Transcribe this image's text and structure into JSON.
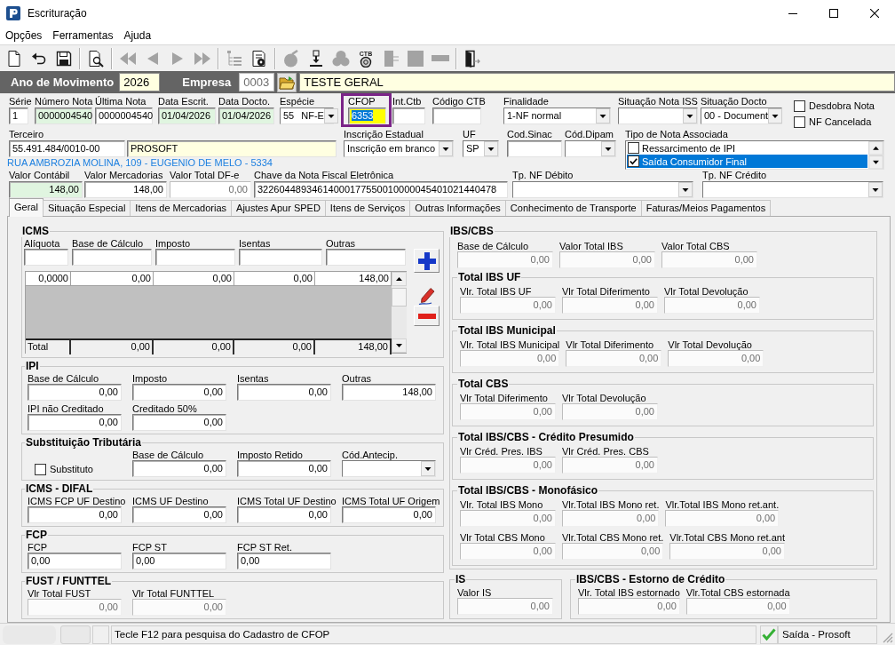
{
  "window": {
    "title": "Escrituração"
  },
  "menu": [
    {
      "label": "Opções"
    },
    {
      "label": "Ferramentas"
    },
    {
      "label": "Ajuda"
    }
  ],
  "toolbar": [
    [
      {
        "kind": "new",
        "disabled": false
      },
      {
        "kind": "undo",
        "disabled": false
      },
      {
        "kind": "save",
        "disabled": false
      }
    ],
    [
      {
        "kind": "preview",
        "disabled": false
      }
    ],
    [
      {
        "kind": "first",
        "disabled": true
      },
      {
        "kind": "previous",
        "disabled": true
      },
      {
        "kind": "next",
        "disabled": true
      },
      {
        "kind": "last",
        "disabled": true
      }
    ],
    [
      {
        "kind": "tree",
        "disabled": true
      },
      {
        "kind": "report",
        "disabled": false
      }
    ],
    [
      {
        "kind": "apple",
        "disabled": true
      },
      {
        "kind": "import",
        "disabled": false
      },
      {
        "kind": "cloud",
        "disabled": true
      },
      {
        "kind": "coin",
        "disabled": false,
        "label": "CTB"
      },
      {
        "kind": "document",
        "disabled": true
      },
      {
        "kind": "panel",
        "disabled": true
      },
      {
        "kind": "bar",
        "disabled": true
      }
    ],
    [
      {
        "kind": "exit",
        "disabled": false
      }
    ]
  ],
  "header": {
    "year_label": "Ano de Movimento",
    "year": {
      "value": "2026",
      "color": "#ffffe1"
    },
    "company_label": "Empresa",
    "company_code": {
      "value": "0003",
      "color": "#ffffff",
      "disabled": true
    },
    "company_name": {
      "value": "TESTE GERAL",
      "color": "#ffffe1"
    }
  },
  "document": {
    "row_1": [
      {
        "label": "Série",
        "value": "1",
        "kind": "text",
        "color": "#ffffff",
        "focused": false,
        "highlighted": false
      },
      {
        "label": "Número Nota",
        "value": "0000004540",
        "kind": "text",
        "color": "#e0f5e0",
        "focused": false,
        "highlighted": false
      },
      {
        "label": "Última Nota",
        "value": "0000004540",
        "kind": "text",
        "color": "#ffffff",
        "focused": false,
        "highlighted": false
      },
      {
        "label": "Data Escrit.",
        "value": "01/04/2026",
        "kind": "text",
        "color": "#e0f5e0",
        "focused": false,
        "highlighted": false
      },
      {
        "label": "Data Docto.",
        "value": "01/04/2026",
        "kind": "text",
        "color": "#e0f5e0",
        "focused": false,
        "highlighted": false
      },
      {
        "label": "Espécie",
        "value": "55",
        "detail": "NF-E",
        "kind": "combo",
        "color": "#ffffff",
        "focused": false,
        "highlighted": false
      },
      {
        "label": "CFOP",
        "value": "6353",
        "kind": "text",
        "color": "#ffff00",
        "focused": true,
        "highlighted": true
      },
      {
        "label": "Int.Ctb",
        "kind": "text",
        "color": "#ffffff",
        "focused": false,
        "highlighted": false
      },
      {
        "label": "Código CTB",
        "kind": "text",
        "color": "#ffffff",
        "focused": false,
        "highlighted": false
      },
      {
        "label": "Finalidade",
        "value": "1-NF normal",
        "kind": "combo",
        "color": "#ffffff",
        "focused": false,
        "highlighted": false
      },
      {
        "label": "Situação Nota ISS",
        "kind": "combo",
        "color": "#ffffff",
        "focused": false,
        "highlighted": false
      },
      {
        "label": "Situação Docto",
        "value": "00 - Document",
        "kind": "combo",
        "color": "#ffffff",
        "focused": false,
        "highlighted": false
      }
    ],
    "flags": [
      {
        "label": "Desdobra Nota",
        "checked": false
      },
      {
        "label": "NF Cancelada",
        "checked": false
      }
    ],
    "row_2": [
      {
        "label": "Terceiro",
        "value": "55.491.484/0010-00",
        "kind": "text",
        "color": "#ffffff"
      },
      {
        "value": "PROSOFT",
        "kind": "text",
        "color": "#ffffe1"
      },
      {
        "label": "Inscrição Estadual",
        "value": "Inscrição em branco",
        "kind": "combo",
        "color": "#ffffff"
      },
      {
        "label": "UF",
        "value": "SP",
        "kind": "combo",
        "color": "#ffffff"
      },
      {
        "label": "Cod.Sinac",
        "kind": "text",
        "color": "#ffffff"
      },
      {
        "label": "Cód.Dipam",
        "kind": "combo",
        "color": "#ffffff"
      }
    ],
    "address": "RUA AMBROZIA MOLINA, 109 - EUGENIO DE MELO - 5334",
    "associated_types": {
      "label": "Tipo de Nota Associada",
      "items": [
        {
          "label": "Ressarcimento de IPI",
          "checked": false,
          "selected": false
        },
        {
          "label": "Saída Consumidor Final",
          "checked": true,
          "selected": true
        }
      ]
    },
    "row_3": [
      {
        "label": "Valor Contábil",
        "value": "148,00",
        "kind": "number",
        "color": "#e0f5e0",
        "disabled": false
      },
      {
        "label": "Valor Mercadorias",
        "value": "148,00",
        "kind": "number",
        "color": "#ffffff",
        "disabled": false
      },
      {
        "label": "Valor Total DF-e",
        "value": "0,00",
        "kind": "number",
        "color": "#ffffff",
        "disabled": true
      },
      {
        "label": "Chave da Nota Fiscal Eletrônica",
        "value": "32260448934614000177550010000045401021440478",
        "kind": "text",
        "color": "#ffffff",
        "disabled": false
      },
      {
        "label": "Tp. NF Débito",
        "kind": "combo",
        "color": "#ffffff",
        "disabled": false
      },
      {
        "label": "Tp. NF Crédito",
        "kind": "combo",
        "color": "#ffffff",
        "disabled": false
      }
    ]
  },
  "tabs": [
    {
      "label": "Geral",
      "selected": true
    },
    {
      "label": "Situação Especial",
      "selected": false
    },
    {
      "label": "Itens de Mercadorias",
      "selected": false
    },
    {
      "label": "Ajustes Apur SPED",
      "selected": false
    },
    {
      "label": "Itens de Serviços",
      "selected": false
    },
    {
      "label": "Outras Informações",
      "selected": false
    },
    {
      "label": "Conhecimento de Transporte",
      "selected": false
    },
    {
      "label": "Faturas/Meios Pagamentos",
      "selected": false
    }
  ],
  "icms": {
    "title": "ICMS",
    "inputs": [
      {
        "label": "Alíquota"
      },
      {
        "label": "Base de Cálculo"
      },
      {
        "label": "Imposto"
      },
      {
        "label": "Isentas"
      },
      {
        "label": "Outras"
      }
    ],
    "rows": [
      [
        "0,0000",
        "0,00",
        "0,00",
        "0,00",
        "148,00"
      ]
    ],
    "total": [
      "Total",
      "0,00",
      "0,00",
      "0,00",
      "148,00"
    ],
    "actions": [
      {
        "kind": "add"
      },
      {
        "kind": "edit"
      },
      {
        "kind": "remove"
      }
    ]
  },
  "left_groups": [
    {
      "title": "IPI",
      "disabled": false,
      "rows": [
        [
          {
            "label": "Base de Cálculo",
            "value": "0,00",
            "kind": "number"
          },
          {
            "label": "Imposto",
            "value": "0,00",
            "kind": "number"
          },
          {
            "label": "Isentas",
            "value": "0,00",
            "kind": "number"
          },
          {
            "label": "Outras",
            "value": "148,00",
            "kind": "number"
          }
        ],
        [
          {
            "label": "IPI não Creditado",
            "value": "0,00",
            "kind": "number"
          },
          {
            "label": "Creditado 50%",
            "value": "0,00",
            "kind": "number"
          }
        ]
      ]
    },
    {
      "title": "Substituição Tributária",
      "disabled": false,
      "rows": [
        [
          {
            "label": "Substituto",
            "kind": "checkbox",
            "checked": false
          },
          {
            "label": "Base de Cálculo",
            "value": "0,00",
            "kind": "number"
          },
          {
            "label": "Imposto Retido",
            "value": "0,00",
            "kind": "number"
          },
          {
            "label": "Cód.Antecip.",
            "kind": "combo"
          }
        ]
      ]
    },
    {
      "title": "ICMS - DIFAL",
      "disabled": false,
      "rows": [
        [
          {
            "label": "ICMS FCP UF Destino",
            "value": "0,00",
            "kind": "number"
          },
          {
            "label": "ICMS UF Destino",
            "value": "0,00",
            "kind": "number"
          },
          {
            "label": "ICMS Total UF Destino",
            "value": "0,00",
            "kind": "number"
          },
          {
            "label": "ICMS Total UF Origem",
            "value": "0,00",
            "kind": "number"
          }
        ]
      ]
    },
    {
      "title": "FCP",
      "disabled": false,
      "rows": [
        [
          {
            "label": "FCP",
            "value": "0,00",
            "kind": "text"
          },
          {
            "label": "FCP ST",
            "value": "0,00",
            "kind": "text"
          },
          {
            "label": "FCP ST Ret.",
            "value": "0,00",
            "kind": "text"
          }
        ]
      ]
    },
    {
      "title": "FUST / FUNTTEL",
      "disabled": true,
      "rows": [
        [
          {
            "label": "Vlr Total FUST",
            "value": "0,00",
            "kind": "number"
          },
          {
            "label": "Vlr Total FUNTTEL",
            "value": "0,00",
            "kind": "number"
          }
        ]
      ]
    }
  ],
  "ibs_cbs": {
    "title": "IBS/CBS",
    "disabled": true,
    "rows": [
      [
        {
          "label": "Base de Cálculo",
          "value": "0,00",
          "kind": "number"
        },
        {
          "label": "Valor Total IBS",
          "value": "0,00",
          "kind": "number"
        },
        {
          "label": "Valor Total CBS",
          "value": "0,00",
          "kind": "number"
        }
      ]
    ],
    "groups": [
      {
        "title": "Total IBS UF",
        "rows": [
          [
            {
              "label": "Vlr. Total IBS UF",
              "value": "0,00",
              "kind": "number"
            },
            {
              "label": "Vlr Total Diferimento",
              "value": "0,00",
              "kind": "number"
            },
            {
              "label": "Vlr Total Devolução",
              "value": "0,00",
              "kind": "number"
            }
          ]
        ]
      },
      {
        "title": "Total IBS Municipal",
        "rows": [
          [
            {
              "label": "Vlr. Total IBS Municipal",
              "value": "0,00",
              "kind": "number"
            },
            {
              "label": "Vlr Total Diferimento",
              "value": "0,00",
              "kind": "number"
            },
            {
              "label": "Vlr Total Devolução",
              "value": "0,00",
              "kind": "number"
            }
          ]
        ]
      },
      {
        "title": "Total CBS",
        "rows": [
          [
            {
              "label": "Vlr Total Diferimento",
              "value": "0,00",
              "kind": "number"
            },
            {
              "label": "Vlr Total Devolução",
              "value": "0,00",
              "kind": "number"
            }
          ]
        ]
      },
      {
        "title": "Total IBS/CBS - Crédito Presumido",
        "rows": [
          [
            {
              "label": "Vlr Créd. Pres. IBS",
              "value": "0,00",
              "kind": "number"
            },
            {
              "label": "Vlr Créd. Pres. CBS",
              "value": "0,00",
              "kind": "number"
            }
          ]
        ]
      },
      {
        "title": "Total IBS/CBS - Monofásico",
        "rows": [
          [
            {
              "label": "Vlr. Total IBS Mono",
              "value": "0,00",
              "kind": "number"
            },
            {
              "label": "Vlr.Total IBS Mono ret.",
              "value": "0,00",
              "kind": "number"
            },
            {
              "label": "Vlr.Total IBS Mono ret.ant.",
              "value": "0,00",
              "kind": "number"
            }
          ],
          [
            {
              "label": "Vlr Total CBS Mono",
              "value": "0,00",
              "kind": "number"
            },
            {
              "label": "Vlr.Total CBS Mono ret.",
              "value": "0,00",
              "kind": "number"
            },
            {
              "label": "Vlr.Total CBS Mono ret.ant",
              "value": "0,00",
              "kind": "number"
            }
          ]
        ]
      }
    ]
  },
  "bottom_groups": [
    {
      "title": "IS",
      "disabled": true,
      "rows": [
        [
          {
            "label": "Valor IS",
            "value": "0,00",
            "kind": "number"
          }
        ]
      ]
    },
    {
      "title": "IBS/CBS - Estorno de Crédito",
      "disabled": true,
      "rows": [
        [
          {
            "label": "Vlr. Total IBS estornado",
            "value": "0,00",
            "kind": "number"
          },
          {
            "label": "Vlr.Total CBS estornada",
            "value": "0,00",
            "kind": "number"
          }
        ]
      ]
    }
  ],
  "status_bar": {
    "message": "Tecle F12 para pesquisa do Cadastro de CFOP",
    "status": "Saída - Prosoft",
    "ok": true
  }
}
